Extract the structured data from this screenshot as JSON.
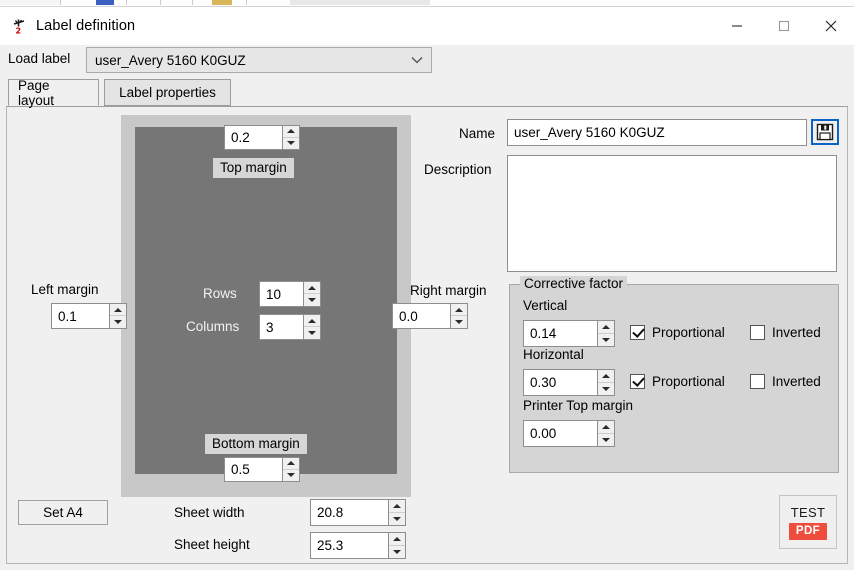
{
  "window": {
    "title": "Label definition",
    "icon": "label-tool-icon",
    "minimize_label": "—",
    "maximize_label": "□",
    "close_label": "✕"
  },
  "load_row": {
    "label": "Load label",
    "selected": "user_Avery 5160 K0GUZ",
    "options": [
      "user_Avery 5160 K0GUZ"
    ]
  },
  "tabs": [
    {
      "label": "Page layout",
      "active": true
    },
    {
      "label": "Label properties",
      "active": false
    }
  ],
  "page_layout": {
    "top_margin": {
      "label": "Top margin",
      "value": "0.2"
    },
    "bottom_margin": {
      "label": "Bottom margin",
      "value": "0.5"
    },
    "left_margin": {
      "label": "Left margin",
      "value": "0.1"
    },
    "right_margin": {
      "label": "Right margin",
      "value": "0.0"
    },
    "rows": {
      "label": "Rows",
      "value": "10"
    },
    "columns": {
      "label": "Columns",
      "value": "3"
    },
    "set_a4_label": "Set A4",
    "sheet_width": {
      "label": "Sheet width",
      "value": "20.8"
    },
    "sheet_height": {
      "label": "Sheet height",
      "value": "25.3"
    }
  },
  "details": {
    "name_label": "Name",
    "name_value": "user_Avery 5160 K0GUZ",
    "description_label": "Description",
    "description_value": "",
    "save_icon": "floppy-disk-icon"
  },
  "corrective_factor": {
    "title": "Corrective factor",
    "vertical": {
      "label": "Vertical",
      "value": "0.14",
      "proportional_label": "Proportional",
      "proportional_checked": true,
      "inverted_label": "Inverted",
      "inverted_checked": false
    },
    "horizontal": {
      "label": "Horizontal",
      "value": "0.30",
      "proportional_label": "Proportional",
      "proportional_checked": true,
      "inverted_label": "Inverted",
      "inverted_checked": false
    },
    "printer_top_margin": {
      "label": "Printer Top margin",
      "value": "0.00"
    }
  },
  "test_pdf": {
    "top_label": "TEST",
    "badge_label": "PDF"
  },
  "colors": {
    "window_bg": "#f0f0f0",
    "preview_outer": "#c8c8c8",
    "preview_inner": "#767676",
    "group_bg": "#d5d5d5",
    "accent_focus": "#0a64c8",
    "pdf_red": "#ef4d3c"
  }
}
